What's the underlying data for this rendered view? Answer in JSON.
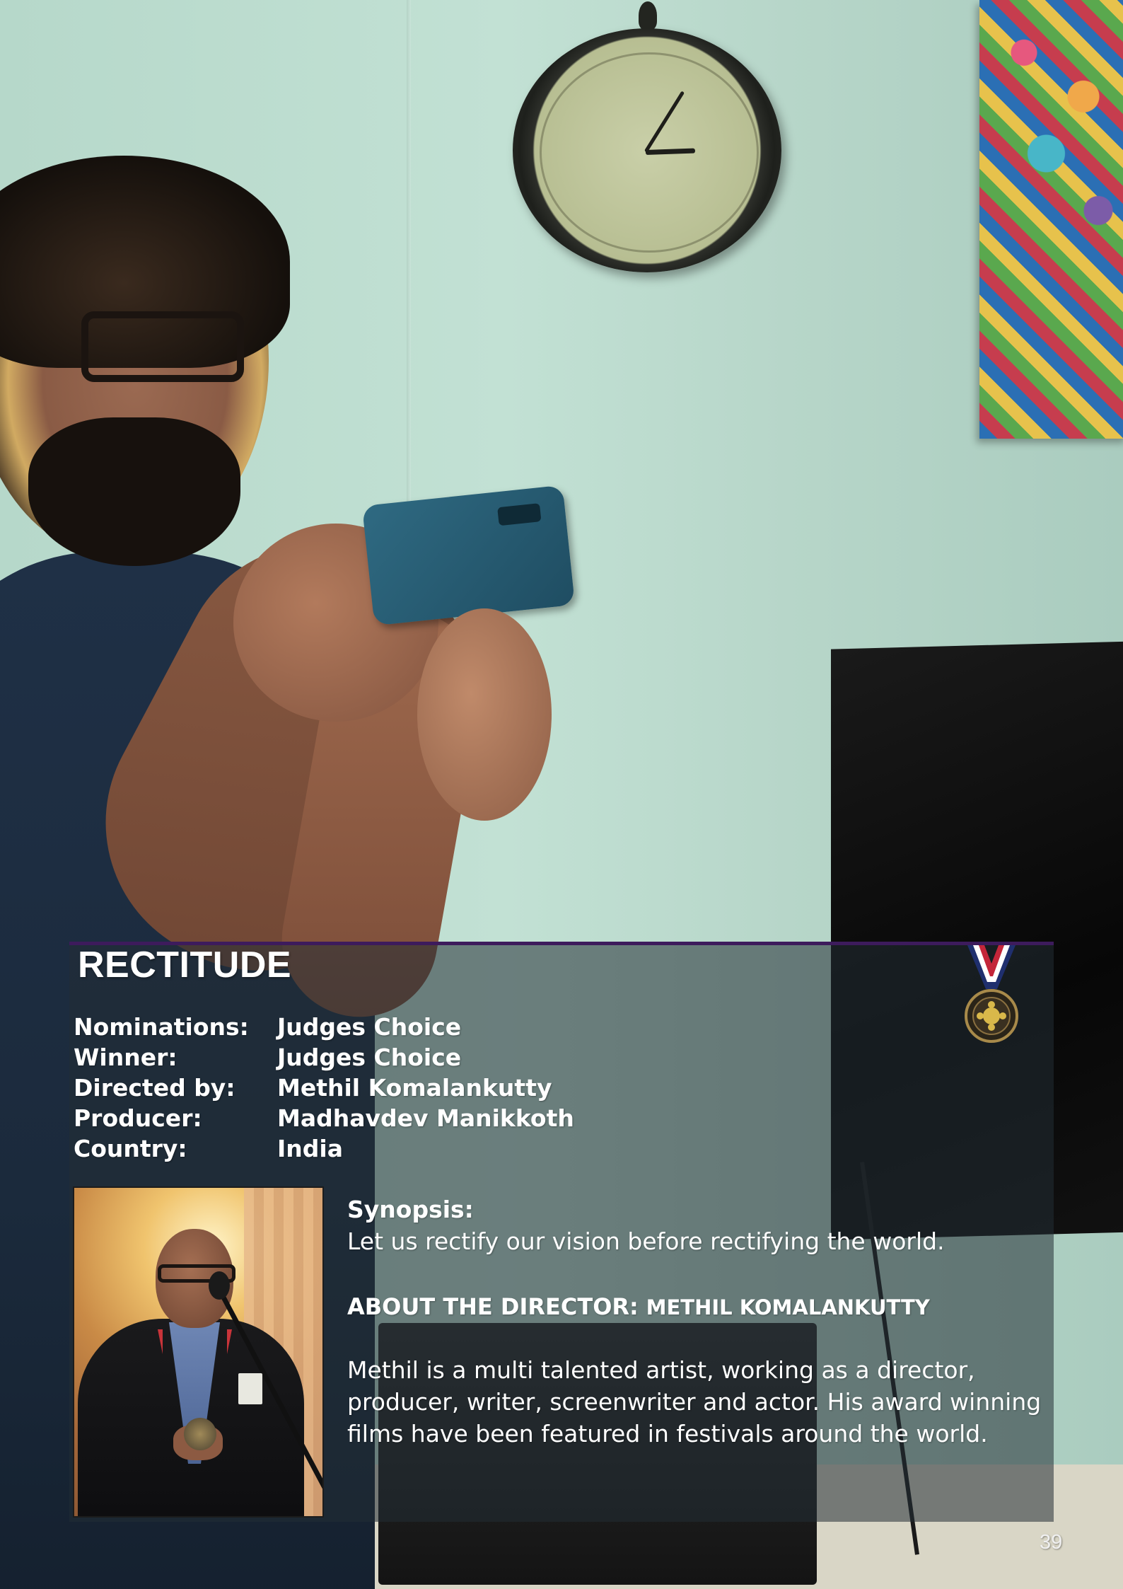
{
  "film": {
    "title": "RECTITUDE",
    "details": [
      {
        "label": "Nominations:",
        "value": "Judges Choice"
      },
      {
        "label": "Winner:",
        "value": "Judges Choice"
      },
      {
        "label": "Directed by:",
        "value": "Methil Komalankutty"
      },
      {
        "label": "Producer:",
        "value": "Madhavdev Manikkoth"
      },
      {
        "label": "Country:",
        "value": "India"
      }
    ],
    "synopsis_label": "Synopsis:",
    "synopsis": "Let us rectify our vision before rectifying the world."
  },
  "director": {
    "about_prefix": "ABOUT THE DIRECTOR:",
    "name": "METHIL KOMALANKUTTY",
    "bio": "Methil is a multi talented artist, working as a director, producer, writer, screenwriter and actor. His award winning films have been featured in festivals around the world."
  },
  "page_number": "39",
  "colors": {
    "rule": "#3d1b5c",
    "panel_overlay": "rgba(34,46,52,0.55)",
    "text": "#ffffff"
  },
  "icons": {
    "award": "medal-icon"
  }
}
